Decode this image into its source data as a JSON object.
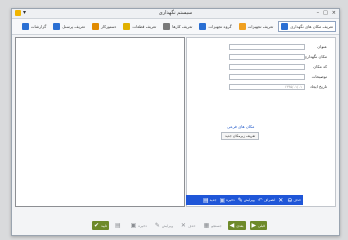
{
  "window": {
    "title": "سیستم نگهداری",
    "controls": [
      "–",
      "□",
      "×"
    ]
  },
  "ribbon": {
    "tabs": [
      {
        "label": "تعریف مکان های نگهداری",
        "color": "#2a6fd3",
        "active": true
      },
      {
        "label": "تعریف تجهیزات",
        "color": "#f0a020"
      },
      {
        "label": "گروه تجهیزات",
        "color": "#2a6fd3"
      },
      {
        "label": "تعریف کارها",
        "color": "#7a7a7a"
      },
      {
        "label": "تعریف قطعات",
        "color": "#e0b000"
      },
      {
        "label": "دستورکار",
        "color": "#e08a00"
      },
      {
        "label": "تعریف پرسنل",
        "color": "#2a6fd3"
      },
      {
        "label": "گزارشات",
        "color": "#2a6fd3"
      }
    ]
  },
  "form": {
    "fields": [
      {
        "label": "عنوان",
        "value": ""
      },
      {
        "label": "مکان نگهداری",
        "value": ""
      },
      {
        "label": "کد مکان",
        "value": ""
      },
      {
        "label": "توضیحات",
        "value": ""
      },
      {
        "label": "تاریخ ایجاد",
        "value": "۱۳۹۵/۰۱/۰۱"
      }
    ],
    "link": "مکان های فرعی",
    "button": "تعریف زیرمکان جدید"
  },
  "panel_toolbar": [
    {
      "label": "حذف",
      "glyph": "⊖",
      "muted": false
    },
    {
      "label": "",
      "glyph": "✕",
      "muted": false
    },
    {
      "label": "انصراف",
      "glyph": "↶",
      "muted": true
    },
    {
      "label": "ویرایش",
      "glyph": "✎",
      "muted": false
    },
    {
      "label": "ذخیره",
      "glyph": "▣",
      "muted": true
    },
    {
      "label": "جدید",
      "glyph": "▤",
      "muted": false
    }
  ],
  "footer": [
    {
      "label": "تایید",
      "glyph": "✔",
      "style": "green"
    },
    {
      "label": "",
      "glyph": "▤",
      "style": "gray"
    },
    {
      "label": "ذخیره",
      "glyph": "▣",
      "style": "gray"
    },
    {
      "label": "ویرایش",
      "glyph": "✎",
      "style": "gray"
    },
    {
      "label": "حذف",
      "glyph": "✕",
      "style": "gray"
    },
    {
      "label": "جستجو",
      "glyph": "▦",
      "style": "gray"
    },
    {
      "label": "بعدی",
      "glyph": "◀",
      "style": "green"
    },
    {
      "label": "قبلی",
      "glyph": "▶",
      "style": "green"
    }
  ]
}
